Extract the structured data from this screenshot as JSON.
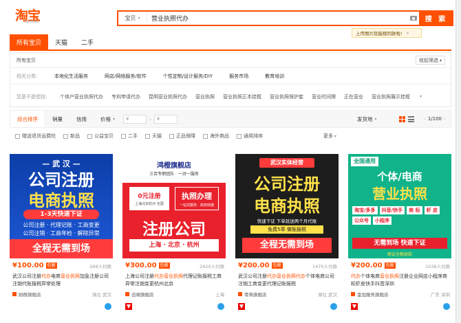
{
  "logo": {
    "text": "淘宝",
    "sub": "taobao"
  },
  "search": {
    "type_label": "宝贝",
    "query": "营业执照代办",
    "button": "搜 索",
    "image_tip": "上传图片就能搜同款啦!"
  },
  "tabs": [
    "所有宝贝",
    "天猫",
    "二手"
  ],
  "filters": {
    "all_label": "所有宝贝",
    "collapse": "收起筛选",
    "related_label": "相关分类:",
    "related": [
      "本地化生活服务",
      "网店/网络服务/软件",
      "个性定制/设计服务/DIY",
      "服务市场",
      "教育培训"
    ],
    "suggest_label": "您是不是想找:",
    "suggest": [
      "个体户营业执照代办",
      "专利申请代办",
      "昆明营业执照代办",
      "营业执照",
      "营业执照正本挂框",
      "营业执照保护套",
      "营业时间牌",
      "正在营业",
      "营业执照展示挂框"
    ]
  },
  "sortbar": {
    "items": [
      "综合排序",
      "销量",
      "信用"
    ],
    "price_label": "价格",
    "price_from": "¥",
    "price_to": "¥",
    "ship_from": "发货地",
    "page": "1/100"
  },
  "checks": [
    "赠送退货运费险",
    "新品",
    "公益宝贝",
    "二手",
    "天猫",
    "正品保障",
    "海外商品",
    "通用排序"
  ],
  "more": "更多",
  "products": [
    {
      "price": "¥100.00",
      "free": "包邮",
      "paid": "268人付款",
      "title_pre": "武汉公司注册",
      "title_hl": "代办",
      "title_mid": "电商",
      "title_hl2": "营业执照",
      "title_post": "加急注册公司注销代账报税异常处理",
      "shop": "财群旗舰店",
      "loc": "湖北 武汉",
      "img": {
        "city": "— 武 汉 —",
        "big1": "公司注册",
        "big2": "电商执照",
        "pill": "1-3天快速下证",
        "s1": "公司注册 · 代理记账 · 工商变更",
        "s2": "公司注销 · 工商年检 · 解除异常",
        "bot": "全程无需到场"
      }
    },
    {
      "price": "¥300.00",
      "free": "包邮",
      "paid": "2420人付款",
      "title_pre": "上海公司注册",
      "title_hl": "代办营业执照",
      "title_mid": "代理记账报税工",
      "title_hl2": "",
      "title_post": "商异常注销变更杭州北京",
      "shop": "迅顺旗舰店",
      "loc": "上海",
      "img": {
        "shop": "鸿橙旗舰店",
        "sub": "三百专职团队 · 一对一服务",
        "lbox": "0元注册",
        "lbox_sub": "上海北京杭州 全国",
        "rbox": "执照办理",
        "rbox_sub": "一站式服务 · 高效快捷",
        "big": "注册公司",
        "cities": "上海 · 北京 · 杭州"
      }
    },
    {
      "price": "¥200.00",
      "free": "包邮",
      "paid": "1470人付款",
      "title_pre": "武汉公司注册",
      "title_hl": "代办营业执照代办",
      "title_mid": "个体电商",
      "title_hl2": "",
      "title_post": "公司注销工商变更代理记账报税",
      "shop": "零燕旗舰店",
      "loc": "湖北 武汉",
      "img": {
        "tag": "武汉实体经营",
        "big1": "公司注册",
        "big2": "电商执照",
        "line": "快速下证  下单就送两个月代账",
        "line2": "免费5章  做账报税",
        "bot": "全程无需到场"
      }
    },
    {
      "price": "¥200.00",
      "free": "包邮",
      "paid": "1038人付款",
      "title_pre": "",
      "title_hl": "代办",
      "title_mid": "个体电商",
      "title_hl2": "营业执照",
      "title_post": "注册企业网店小程序商标虾皮快手抖音深圳",
      "shop": "金加服务旗舰店",
      "loc": "广东 深圳",
      "img": {
        "corner": "全国通用",
        "big1": "个体/电商",
        "big2": "营业执照",
        "chips": [
          "淘宝/多多",
          "抖音/快手",
          "商 标",
          "虾 皮",
          "公众号",
          "小程序"
        ],
        "bot": "无需到场 快速下证",
        "ask": "假证全额退款"
      }
    }
  ]
}
